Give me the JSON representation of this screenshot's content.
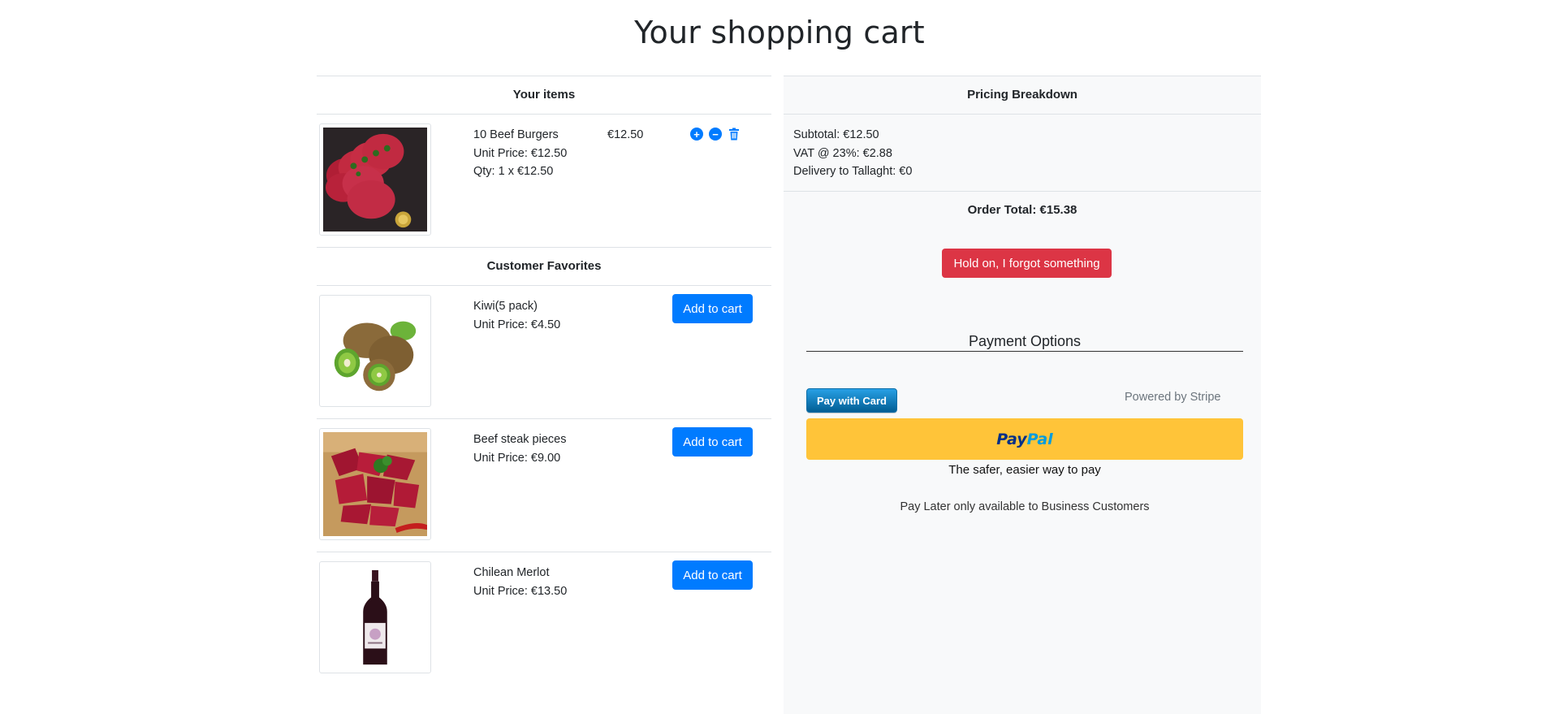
{
  "page_title": "Your shopping cart",
  "cart": {
    "header": "Your items",
    "items": [
      {
        "name": "10 Beef Burgers",
        "unit_price": "Unit Price: €12.50",
        "qty": "Qty: 1 x €12.50",
        "line_total": "€12.50",
        "image": "beef-burgers-image"
      }
    ],
    "actions": {
      "increase_icon": "plus-circle-icon",
      "decrease_icon": "minus-circle-icon",
      "remove_icon": "trash-icon"
    }
  },
  "favorites": {
    "header": "Customer Favorites",
    "add_label": "Add to cart",
    "items": [
      {
        "name": "Kiwi(5 pack)",
        "unit_price": "Unit Price: €4.50",
        "image": "kiwi-image"
      },
      {
        "name": "Beef steak pieces",
        "unit_price": "Unit Price: €9.00",
        "image": "beef-steak-image"
      },
      {
        "name": "Chilean Merlot",
        "unit_price": "Unit Price: €13.50",
        "image": "wine-bottle-image"
      }
    ]
  },
  "pricing": {
    "header": "Pricing Breakdown",
    "subtotal": "Subtotal: €12.50",
    "vat": "VAT @ 23%: €2.88",
    "delivery": "Delivery to Tallaght: €0",
    "order_total": "Order Total: €15.38",
    "forgot_button": "Hold on, I forgot something"
  },
  "payment": {
    "heading": "Payment Options",
    "stripe_button": "Pay with Card",
    "powered_by": "Powered by Stripe",
    "paypal_logo_part1": "Pay",
    "paypal_logo_part2": "Pal",
    "paypal_tagline": "The safer, easier way to pay",
    "pay_later_note": "Pay Later only available to Business Customers"
  },
  "colors": {
    "primary": "#007bff",
    "danger": "#dc3545",
    "paypal_yellow": "#ffc439",
    "panel_bg": "#f8f9fa"
  }
}
